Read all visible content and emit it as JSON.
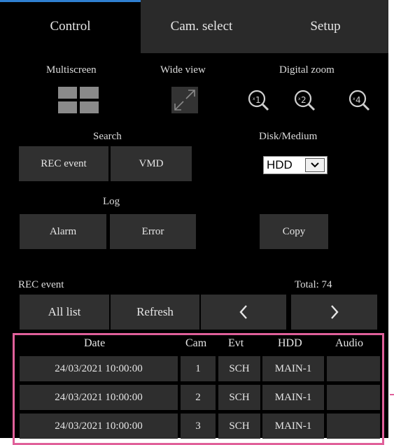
{
  "tabs": {
    "control": "Control",
    "cam_select": "Cam. select",
    "setup": "Setup"
  },
  "labels": {
    "multiscreen": "Multiscreen",
    "wide_view": "Wide view",
    "digital_zoom": "Digital zoom",
    "search": "Search",
    "disk_medium": "Disk/Medium",
    "log": "Log",
    "rec_event": "REC event",
    "total": "Total:  74"
  },
  "buttons": {
    "rec_event": "REC event",
    "vmd": "VMD",
    "alarm": "Alarm",
    "error": "Error",
    "copy": "Copy",
    "all_list": "All list",
    "refresh": "Refresh",
    "prev": "<",
    "next": ">"
  },
  "zoom": {
    "x1": "x1",
    "x2": "x2",
    "x4": "x4"
  },
  "disk_select": {
    "value": "HDD"
  },
  "table": {
    "headers": {
      "date": "Date",
      "cam": "Cam",
      "evt": "Evt",
      "hdd": "HDD",
      "audio": "Audio"
    },
    "rows": [
      {
        "date": "24/03/2021  10:00:00",
        "cam": "1",
        "evt": "SCH",
        "hdd": "MAIN-1",
        "audio": ""
      },
      {
        "date": "24/03/2021  10:00:00",
        "cam": "2",
        "evt": "SCH",
        "hdd": "MAIN-1",
        "audio": ""
      },
      {
        "date": "24/03/2021  10:00:00",
        "cam": "3",
        "evt": "SCH",
        "hdd": "MAIN-1",
        "audio": ""
      }
    ]
  },
  "colors": {
    "tab_accent": "#2f7fd1",
    "table_highlight": "#e0609a"
  },
  "icons": [
    "multiscreen-icon",
    "wide-view-icon",
    "zoom-x1-icon",
    "zoom-x2-icon",
    "zoom-x4-icon",
    "chevron-down-icon"
  ]
}
